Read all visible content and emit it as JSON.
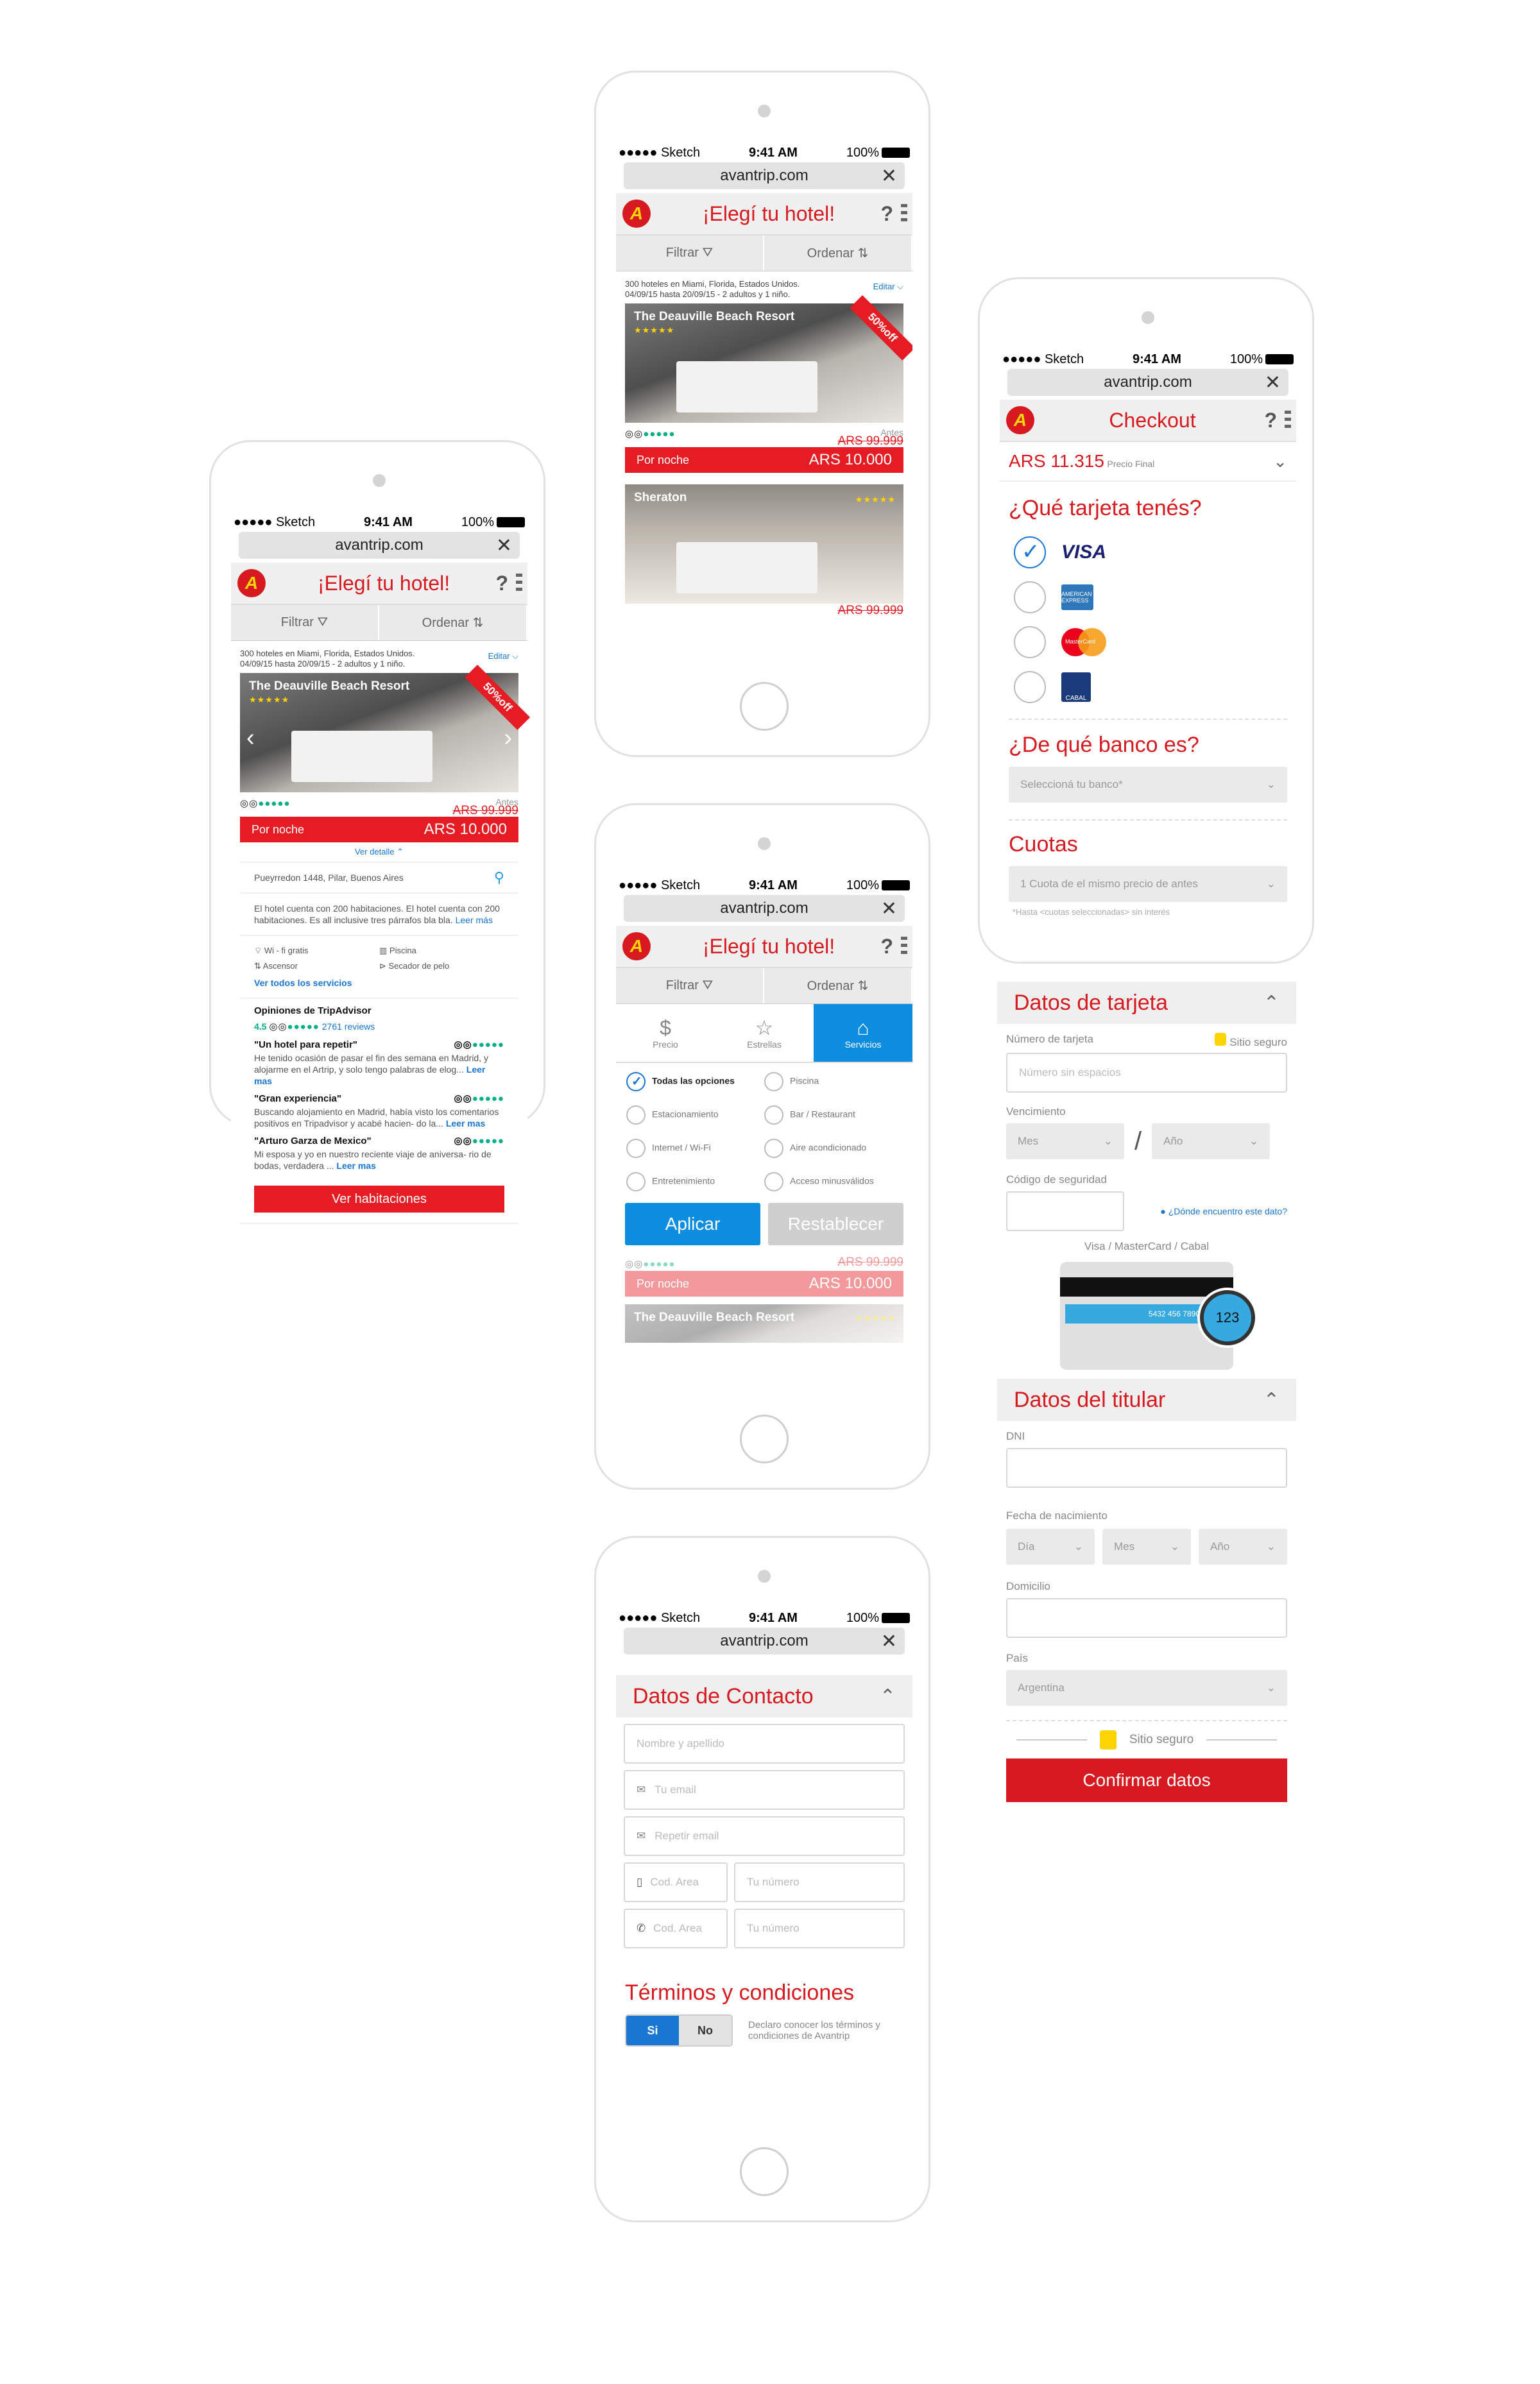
{
  "status": {
    "carrier": "●●●●● Sketch",
    "time": "9:41 AM",
    "battery": "100%"
  },
  "url": "avantrip.com",
  "close_glyph": "✕",
  "header": {
    "logo": "A",
    "hotels_title": "¡Elegí tu hotel!",
    "checkout_title": "Checkout",
    "help": "?"
  },
  "filterbar": {
    "filter": "Filtrar ⛛",
    "order": "Ordenar ⇅"
  },
  "search_meta": {
    "line1": "300 hoteles en Miami, Florida, Estados Unidos.",
    "line2": "04/09/15 hasta 20/09/15 - 2 adultos y 1 niño.",
    "edit": "Editar ⌵"
  },
  "hotel1": {
    "name": "The Deauville Beach Resort",
    "stars": "★★★★★",
    "ribbon": "50%off",
    "rating_icon": "◎◎",
    "rating_dots": "●●●●●",
    "before_label": "Antes",
    "before_price": "ARS 99.999",
    "night_label": "Por noche",
    "price": "ARS 10.000"
  },
  "hotel2": {
    "name": "Sheraton",
    "stars": "★★★★★",
    "before_price": "ARS 99.999"
  },
  "detail": {
    "toggle": "Ver detalle ⌃",
    "address": "Pueyrredon 1448, Pilar, Buenos Aires",
    "description": "El hotel cuenta con 200 habitaciones. El hotel cuenta con 200 habitaciones. Es all inclusive tres párrafos bla bla.",
    "read_more": "Leer más",
    "amenities": [
      "Wi - fi gratis",
      "Piscina",
      "Ascensor",
      "Secador de pelo"
    ],
    "amenity_icons": [
      "wifi-icon",
      "pool-icon",
      "elevator-icon",
      "hairdryer-icon"
    ],
    "all_services": "Ver todos los servicios",
    "ta_title": "Opiniones de TripAdvisor",
    "ta_score": "4.5",
    "ta_reviews": "2761 reviews",
    "reviews": [
      {
        "title": "\"Un hotel para repetir\"",
        "text": "He tenido ocasión de pasar el fin des semana en Madrid, y alojarme en el Artrip, y solo tengo palabras de elog...",
        "more": "Leer mas"
      },
      {
        "title": "\"Gran experiencia\"",
        "text": "Buscando alojamiento en Madrid, había visto los comentarios positivos en Tripadvisor y acabé hacien- do la...",
        "more": "Leer mas"
      },
      {
        "title": "\"Arturo Garza de Mexico\"",
        "text": "Mi esposa y yo en nuestro reciente viaje de aniversa- rio de bodas, verdadera ...",
        "more": "Leer mas"
      }
    ],
    "rooms_button": "Ver habitaciones"
  },
  "filters": {
    "tabs": [
      {
        "icon": "$",
        "label": "Precio"
      },
      {
        "icon": "☆",
        "label": "Estrellas"
      },
      {
        "icon": "⌂",
        "label": "Servicios"
      }
    ],
    "options": [
      "Todas las opciones",
      "Piscina",
      "Estacionamiento",
      "Bar / Restaurant",
      "Internet / Wi-Fi",
      "Aire acondicionado",
      "Entretenimiento",
      "Acceso minusválidos"
    ],
    "apply": "Aplicar",
    "reset": "Restablecer"
  },
  "contact": {
    "title": "Datos de Contacto",
    "chevron": "⌃",
    "name_ph": "Nombre y apellido",
    "email_ph": "Tu email",
    "email2_ph": "Repetir email",
    "area_ph": "Cod. Area",
    "number_ph": "Tu número",
    "terms_title": "Términos y condiciones",
    "yes": "Si",
    "no": "No",
    "terms_text": "Declaro conocer los términos y condiciones de Avantrip"
  },
  "checkout": {
    "total": "ARS 11.315",
    "total_label": "Precio Final",
    "card_q": "¿Qué tarjeta tenés?",
    "visa": "VISA",
    "amex": "AMERICAN EXPRESS",
    "mastercard": "MasterCard",
    "cabal": "CABAL",
    "bank_q": "¿De qué banco es?",
    "bank_ph": "Seleccioná tu banco*",
    "cuotas_title": "Cuotas",
    "cuotas_value": "1 Cuota de el mismo precio de antes",
    "cuotas_note": "*Hasta <cuotas seleccionadas> sin interés",
    "card_data_title": "Datos de tarjeta",
    "card_number_label": "Número de tarjeta",
    "secure": "Sitio seguro",
    "card_number_ph": "Número sin espacios",
    "expiry_label": "Vencimiento",
    "month": "Mes",
    "year": "Año",
    "slash": "/",
    "cvv_label": "Código de seguridad",
    "cvv_help": "¿Dónde encuentro este dato?",
    "card_types": "Visa / MasterCard / Cabal",
    "card_digits": "5432 456 7890",
    "cvv_example": "123",
    "holder_title": "Datos del titular",
    "dni_label": "DNI",
    "birth_label": "Fecha de nacimiento",
    "day": "Día",
    "address_label": "Domicilio",
    "country_label": "País",
    "country_value": "Argentina",
    "confirm": "Confirmar datos"
  },
  "colors": {
    "brand_red": "#d71920",
    "accent_blue": "#0d8de0",
    "tripadvisor_green": "#00af87"
  }
}
